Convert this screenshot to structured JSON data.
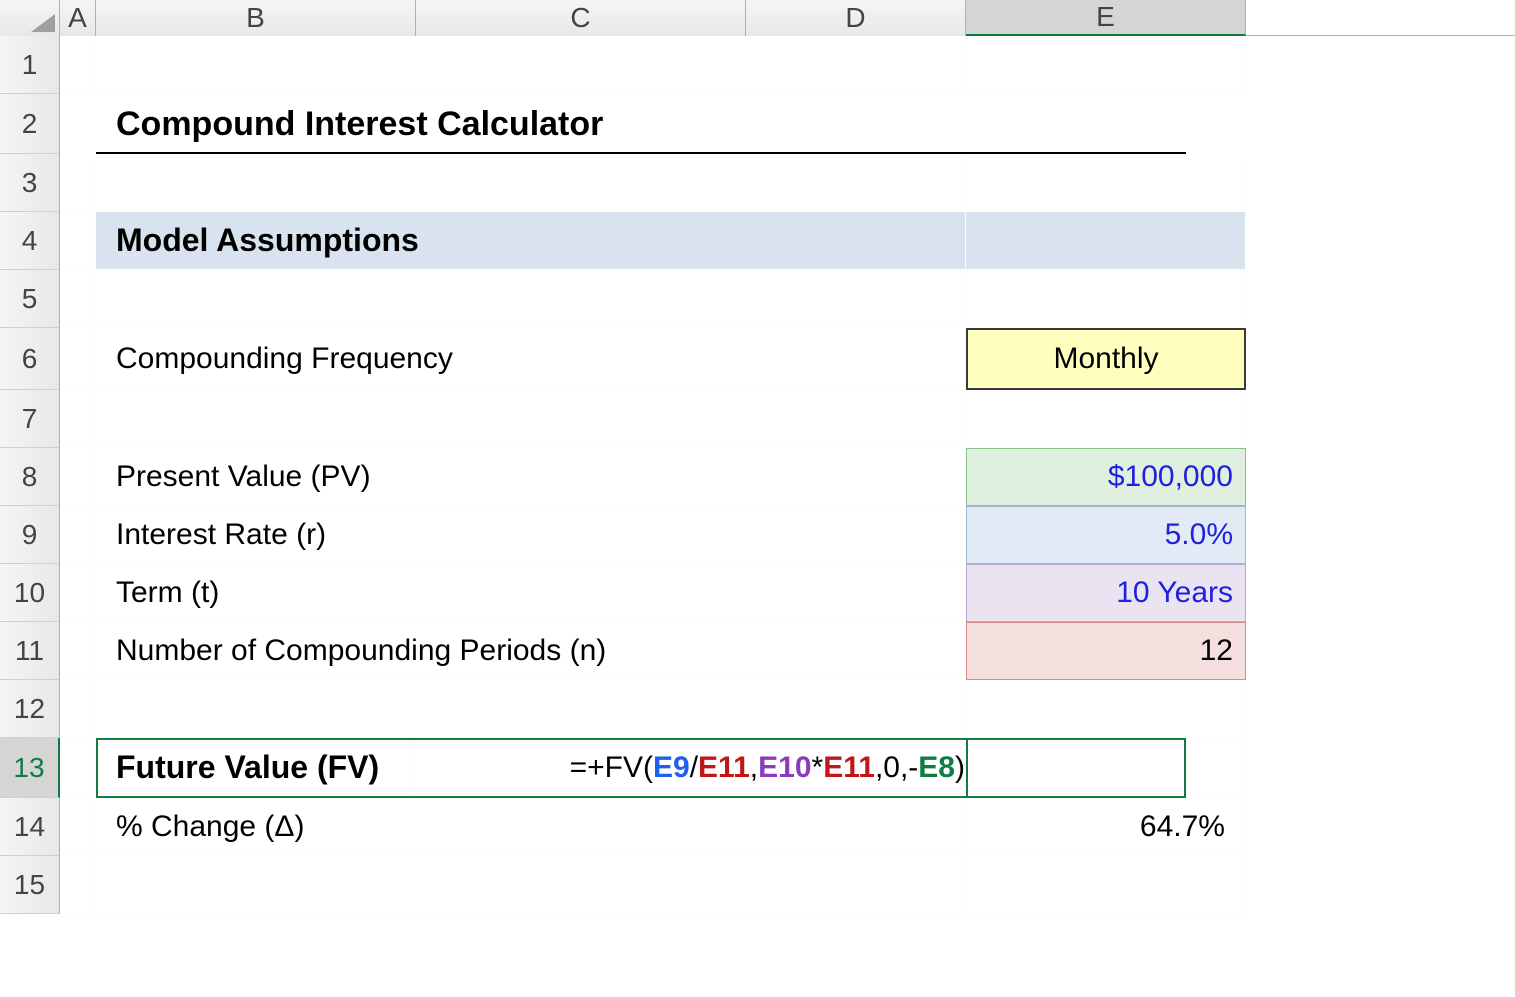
{
  "columns": {
    "A": "A",
    "B": "B",
    "C": "C",
    "D": "D",
    "E": "E"
  },
  "row_numbers": [
    "1",
    "2",
    "3",
    "4",
    "5",
    "6",
    "7",
    "8",
    "9",
    "10",
    "11",
    "12",
    "13",
    "14",
    "15"
  ],
  "title": "Compound Interest Calculator",
  "section_header": "Model Assumptions",
  "rows": {
    "compounding_freq": {
      "label": "Compounding Frequency",
      "value": "Monthly"
    },
    "present_value": {
      "label": "Present Value (PV)",
      "value": "$100,000"
    },
    "interest_rate": {
      "label": "Interest Rate (r)",
      "value": "5.0%"
    },
    "term": {
      "label": "Term (t)",
      "value": "10 Years"
    },
    "num_periods": {
      "label": "Number of Compounding Periods (n)",
      "value": "12"
    },
    "future_value": {
      "label": "Future Value (FV)"
    },
    "pct_change": {
      "label": "% Change (Δ)",
      "value": "64.7%"
    }
  },
  "formula": {
    "prefix": "=+FV(",
    "ref1": "E9",
    "sep1": "/",
    "ref2": "E11",
    "sep2": ",",
    "ref3": "E10",
    "sep3": "*",
    "ref4": "E11",
    "sep4": ",0,-",
    "ref5": "E8",
    "suffix": ")"
  },
  "selected": {
    "column": "E",
    "row": "13"
  }
}
